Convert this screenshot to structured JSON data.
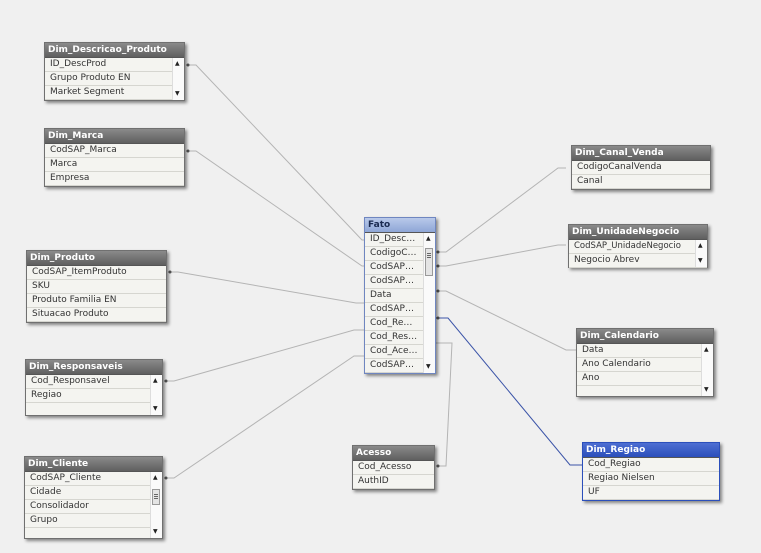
{
  "tables": {
    "descricao": {
      "title": "Dim_Descricao_Produto",
      "fields": [
        "ID_DescProd",
        "Grupo Produto EN",
        "Market Segment"
      ]
    },
    "marca": {
      "title": "Dim_Marca",
      "fields": [
        "CodSAP_Marca",
        "Marca",
        "Empresa"
      ]
    },
    "produto": {
      "title": "Dim_Produto",
      "fields": [
        "CodSAP_ItemProduto",
        "SKU",
        "Produto Familia EN",
        "Situacao Produto"
      ]
    },
    "responsaveis": {
      "title": "Dim_Responsaveis",
      "fields": [
        "Cod_Responsavel",
        "Regiao"
      ]
    },
    "cliente": {
      "title": "Dim_Cliente",
      "fields": [
        "CodSAP_Cliente",
        "Cidade",
        "Consolidador",
        "Grupo"
      ]
    },
    "fato": {
      "title": "Fato",
      "fields": [
        "ID_Desc…",
        "CodigoC…",
        "CodSAP…",
        "CodSAP…",
        "Data",
        "CodSAP…",
        "Cod_Re…",
        "Cod_Res…",
        "Cod_Ace…",
        "CodSAP…"
      ]
    },
    "acesso": {
      "title": "Acesso",
      "fields": [
        "Cod_Acesso",
        "AuthID"
      ]
    },
    "canal": {
      "title": "Dim_Canal_Venda",
      "fields": [
        "CodigoCanalVenda",
        "Canal"
      ]
    },
    "unidade": {
      "title": "Dim_UnidadeNegocio",
      "fields": [
        "CodSAP_UnidadeNegocio",
        "Negocio Abrev"
      ]
    },
    "calendario": {
      "title": "Dim_Calendario",
      "fields": [
        "Data",
        "Ano Calendario",
        "Ano"
      ]
    },
    "regiao": {
      "title": "Dim_Regiao",
      "fields": [
        "Cod_Regiao",
        "Regiao Nielsen",
        "UF"
      ]
    }
  },
  "colors": {
    "link": "#b4b4b4",
    "selected_link": "#3b54a8",
    "selected_header": "#2b4fbb",
    "fato_header": "#9fb3df"
  }
}
